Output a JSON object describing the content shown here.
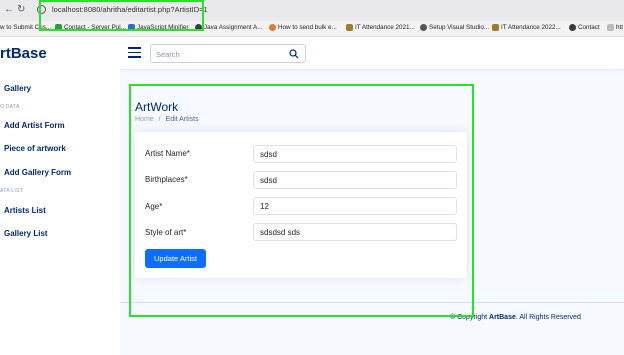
{
  "browser": {
    "url": "localhost:8080/ahritha/editartist.php?ArtistID=1",
    "bookmarks": [
      "w to Submit Cus...",
      "Contact - Server Pul...",
      "JavaScript Minifier",
      "Java Assignment A...",
      "How to send bulk e...",
      "IT Attendance 2021...",
      "Setup Visual Studio...",
      "IT Attendance 2022...",
      "Contact",
      "htt"
    ],
    "bookmark_colors": [
      "#777777",
      "#2a9d3a",
      "#2f6ad0",
      "#3a3a3a",
      "#e07a2a",
      "#a07a2a",
      "#555555",
      "#a07a2a",
      "#3a3a3a",
      "#888888"
    ]
  },
  "header": {
    "logo": "rtBase",
    "search_placeholder": "Search"
  },
  "sidebar": {
    "gallery": "Gallery",
    "section_data": "O DATA",
    "add_artist": "Add Artist Form",
    "piece": "Piece of artwork",
    "add_gallery": "Add Gallery Form",
    "section_list": "ATA LIST",
    "artists_list": "Artists List",
    "gallery_list": "Gallery List"
  },
  "main": {
    "title": "ArtWork",
    "breadcrumb_home": "Home",
    "breadcrumb_sep": "/",
    "breadcrumb_current": "Edit Artists",
    "fields": [
      {
        "label": "Artist Name*",
        "value": "sdsd"
      },
      {
        "label": "Birthplaces*",
        "value": "sdsd"
      },
      {
        "label": "Age*",
        "value": "12"
      },
      {
        "label": "Style of art*",
        "value": "sdsdsd sds"
      }
    ],
    "submit_label": "Update Artist"
  },
  "footer": {
    "prefix": "© Copyright",
    "brand": "ArtBase",
    "suffix": ". All Rights Reserved"
  },
  "colors": {
    "brand": "#012970",
    "primary_button": "#0d6efd",
    "background": "#f6f9ff",
    "highlight": "#2be02b"
  }
}
